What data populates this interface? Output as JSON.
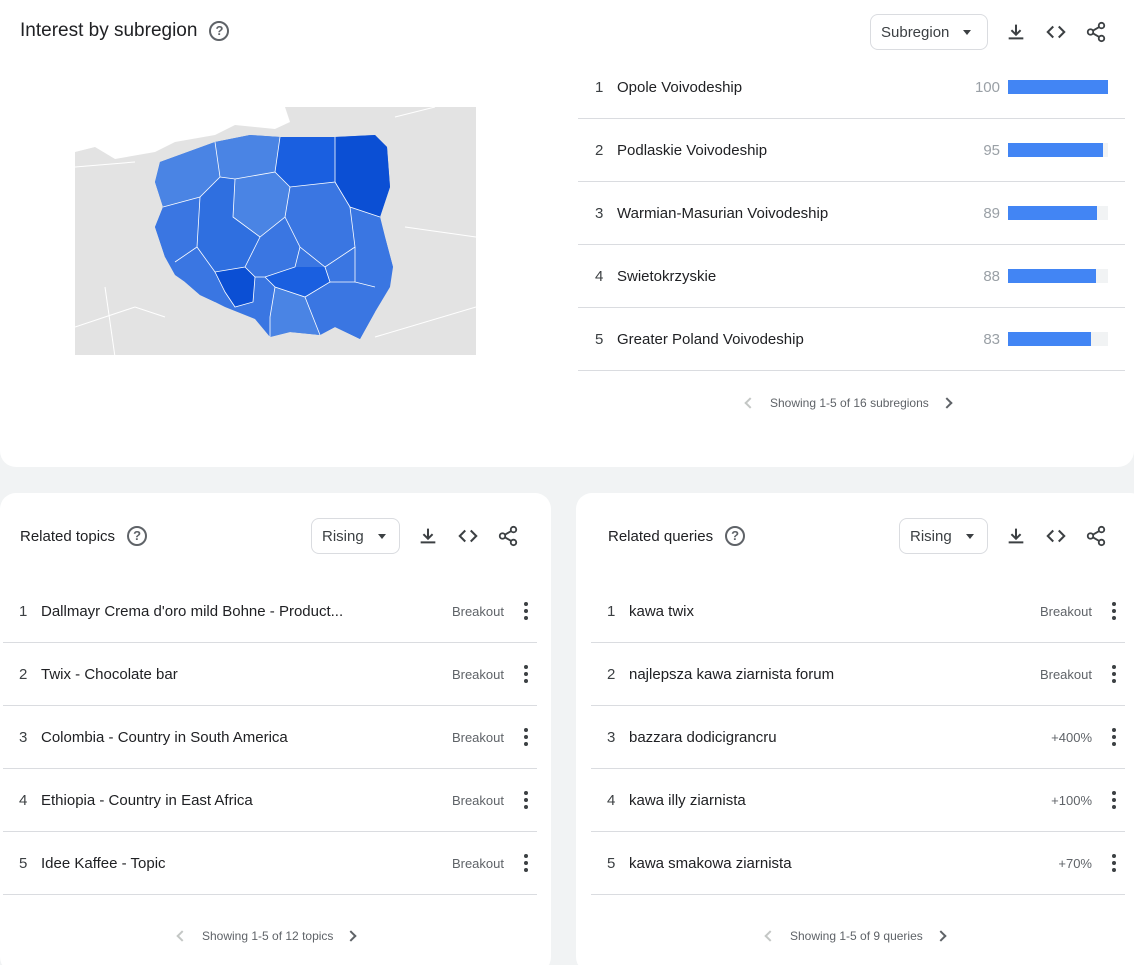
{
  "subregion": {
    "title": "Interest by subregion",
    "dropdown": "Subregion",
    "icons": [
      "help-icon",
      "download-icon",
      "embed-code-icon",
      "share-icon"
    ],
    "rows": [
      {
        "rank": "1",
        "name": "Opole Voivodeship",
        "value": "100",
        "share": 1.0
      },
      {
        "rank": "2",
        "name": "Podlaskie Voivodeship",
        "value": "95",
        "share": 0.95
      },
      {
        "rank": "3",
        "name": "Warmian-Masurian Voivodeship",
        "value": "89",
        "share": 0.89
      },
      {
        "rank": "4",
        "name": "Swietokrzyskie",
        "value": "88",
        "share": 0.88
      },
      {
        "rank": "5",
        "name": "Greater Poland Voivodeship",
        "value": "83",
        "share": 0.83
      }
    ],
    "pager": "Showing 1-5 of 16 subregions",
    "bar_color": "#4285f4"
  },
  "topics": {
    "title": "Related topics",
    "dropdown": "Rising",
    "rows": [
      {
        "rank": "1",
        "label": "Dallmayr Crema d'oro mild Bohne - Product...",
        "status": "Breakout"
      },
      {
        "rank": "2",
        "label": "Twix - Chocolate bar",
        "status": "Breakout"
      },
      {
        "rank": "3",
        "label": "Colombia - Country in South America",
        "status": "Breakout"
      },
      {
        "rank": "4",
        "label": "Ethiopia - Country in East Africa",
        "status": "Breakout"
      },
      {
        "rank": "5",
        "label": "Idee Kaffee - Topic",
        "status": "Breakout"
      }
    ],
    "pager": "Showing 1-5 of 12 topics"
  },
  "queries": {
    "title": "Related queries",
    "dropdown": "Rising",
    "rows": [
      {
        "rank": "1",
        "label": "kawa twix",
        "status": "Breakout"
      },
      {
        "rank": "2",
        "label": "najlepsza kawa ziarnista forum",
        "status": "Breakout"
      },
      {
        "rank": "3",
        "label": "bazzara dodicigrancru",
        "status": "+400%"
      },
      {
        "rank": "4",
        "label": "kawa illy ziarnista",
        "status": "+100%"
      },
      {
        "rank": "5",
        "label": "kawa smakowa ziarnista",
        "status": "+70%"
      }
    ],
    "pager": "Showing 1-5 of 9 queries"
  },
  "map": {
    "region": "Poland",
    "colors": {
      "background": "#e3e3e3",
      "darkest": "#0b4fd4",
      "dark": "#1a5fe0",
      "mid": "#2f6fe0",
      "light": "#4a84e4"
    }
  }
}
